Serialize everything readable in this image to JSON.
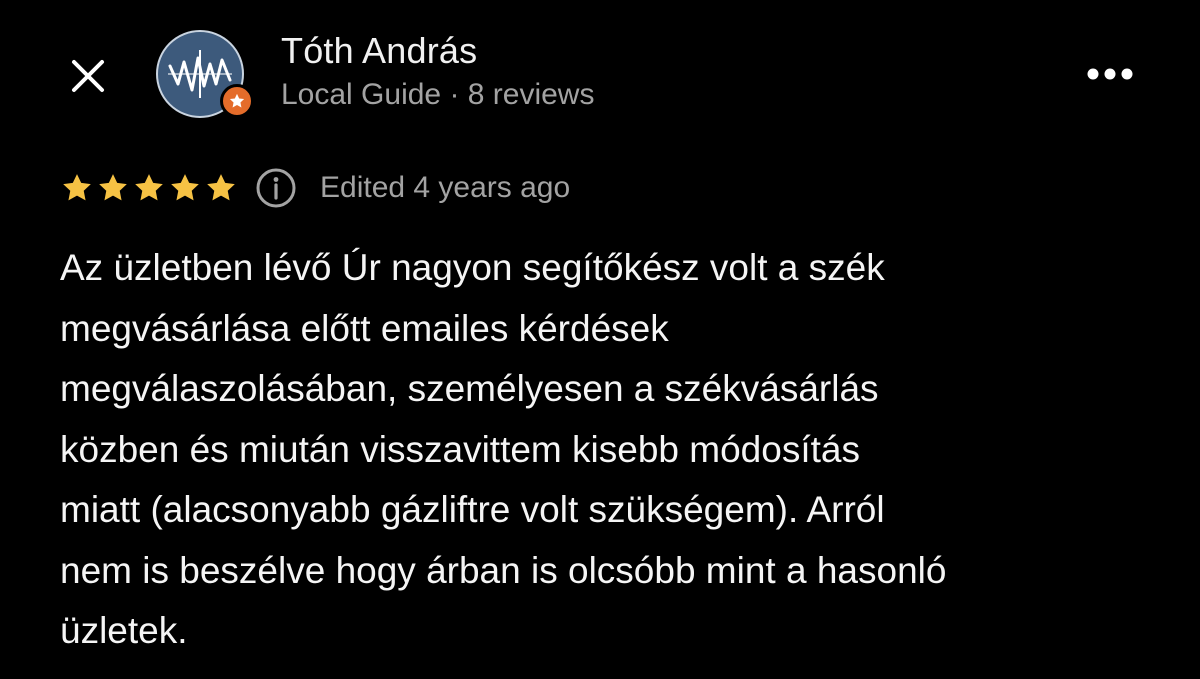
{
  "header": {
    "close_icon": "close-icon",
    "author_name": "Tóth András",
    "author_meta": "Local Guide · 8 reviews",
    "avatar_icon": "avatar-logo",
    "badge_icon": "star-icon",
    "more_icon": "more-horizontal-icon"
  },
  "review": {
    "rating": 5,
    "rating_max": 5,
    "info_icon": "info-icon",
    "edited_label": "Edited 4 years ago",
    "text_lines": [
      "Az üzletben lévő Úr nagyon segítőkész volt a szék",
      "megvásárlása előtt emailes kérdések",
      "megválaszolásában, személyesen a székvásárlás",
      "közben és miután visszavittem kisebb módosítás",
      "miatt (alacsonyabb gázliftre volt szükségem). Arról",
      "nem is beszélve hogy árban is olcsóbb mint a hasonló",
      "üzletek."
    ]
  },
  "colors": {
    "background": "#000000",
    "star": "#f6c244",
    "badge": "#e46c2a",
    "secondary_text": "#a3a3a3",
    "primary_text": "#f5f5f5"
  }
}
